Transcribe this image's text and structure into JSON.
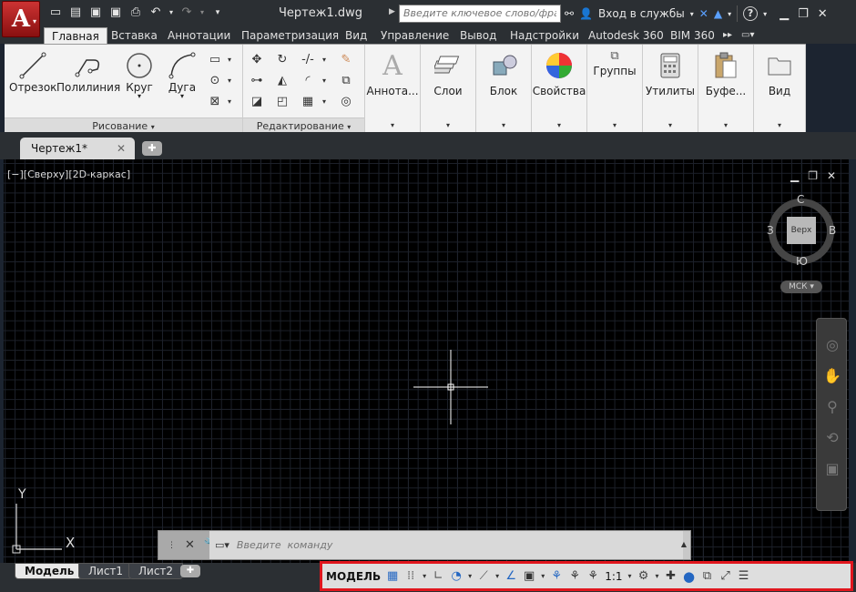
{
  "titlebar": {
    "document_title": "Чертеж1.dwg",
    "search_placeholder": "Введите ключевое слово/фразу",
    "sign_in": "Вход в службы",
    "help": "?"
  },
  "ribbon_tabs": [
    {
      "label": "Главная"
    },
    {
      "label": "Вставка"
    },
    {
      "label": "Аннотации"
    },
    {
      "label": "Параметризация"
    },
    {
      "label": "Вид"
    },
    {
      "label": "Управление"
    },
    {
      "label": "Вывод"
    },
    {
      "label": "Надстройки"
    },
    {
      "label": "Autodesk 360"
    },
    {
      "label": "BIM 360"
    }
  ],
  "ribbon": {
    "draw_panel": {
      "title": "Рисование",
      "tools": [
        {
          "label": "Отрезок",
          "icon": "line-icon"
        },
        {
          "label": "Полилиния",
          "icon": "polyline-icon"
        },
        {
          "label": "Круг",
          "icon": "circle-icon"
        },
        {
          "label": "Дуга",
          "icon": "arc-icon"
        }
      ]
    },
    "modify_panel": {
      "title": "Редактирование"
    },
    "big_panels": [
      {
        "label": "Аннота...",
        "icon": "annotation-icon"
      },
      {
        "label": "Слои",
        "icon": "layers-icon"
      },
      {
        "label": "Блок",
        "icon": "block-icon"
      },
      {
        "label": "Свойства",
        "icon": "properties-icon"
      },
      {
        "label": "Группы",
        "icon": "groups-icon"
      },
      {
        "label": "Утилиты",
        "icon": "utilities-icon"
      },
      {
        "label": "Буфе...",
        "icon": "clipboard-icon"
      },
      {
        "label": "Вид",
        "icon": "view-icon"
      }
    ]
  },
  "doc_tabs": [
    {
      "label": "Чертеж1*"
    }
  ],
  "viewport": {
    "label": "[−][Сверху][2D-каркас]",
    "viewcube": {
      "face": "Верх",
      "north": "С",
      "south": "Ю",
      "east": "В",
      "west": "З",
      "wcs": "МСК"
    }
  },
  "ucs": {
    "x": "X",
    "y": "Y"
  },
  "command_line": {
    "placeholder": "Введите  команду"
  },
  "layout_tabs": [
    {
      "label": "Модель",
      "active": true
    },
    {
      "label": "Лист1",
      "active": false
    },
    {
      "label": "Лист2",
      "active": false
    }
  ],
  "status_bar": {
    "model_label": "МОДЕЛЬ",
    "annotation_scale": "1:1",
    "highlighted_color": "#e0161d"
  },
  "colors": {
    "accent": "#2467c2",
    "app_button": "#c33333"
  }
}
